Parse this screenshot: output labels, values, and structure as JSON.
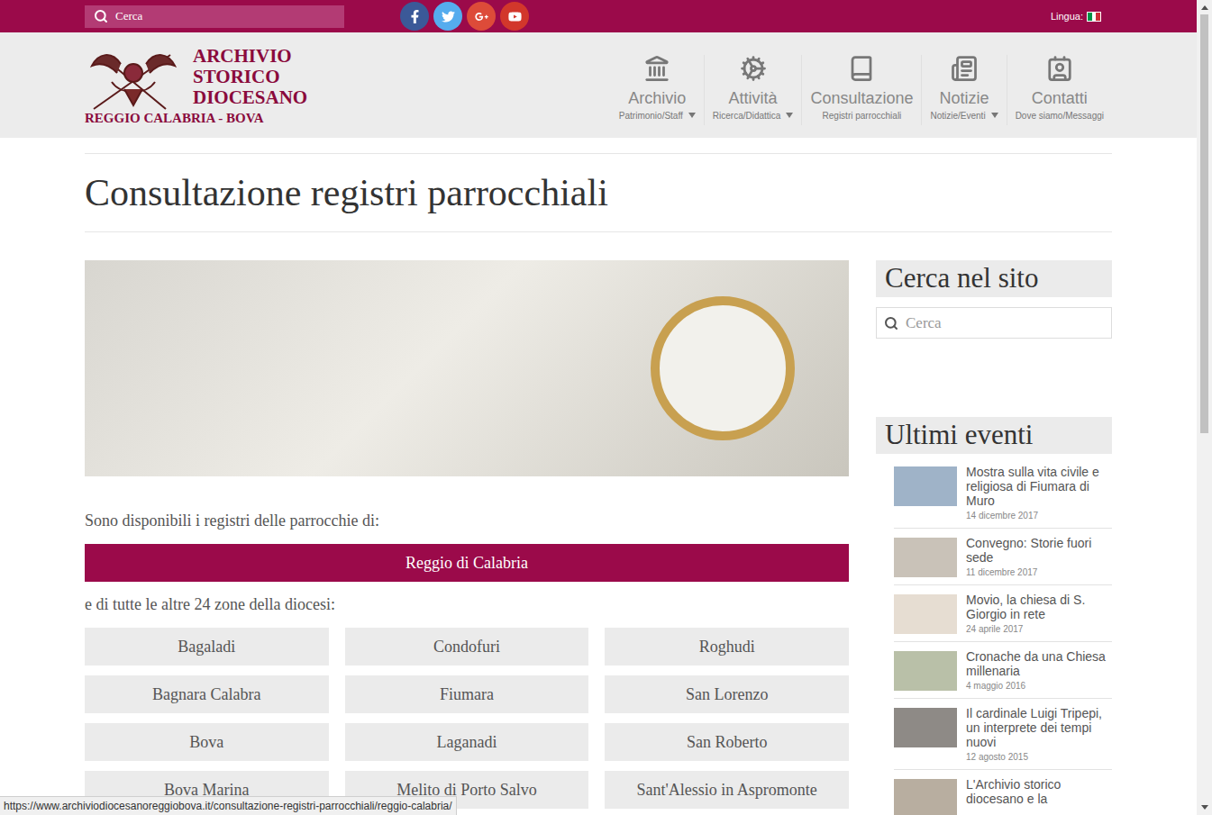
{
  "top_bar": {
    "search_placeholder": "Cerca",
    "social": [
      {
        "name": "facebook",
        "color": "#3b5998"
      },
      {
        "name": "twitter",
        "color": "#55acee"
      },
      {
        "name": "google-plus",
        "color": "#dd4b39"
      },
      {
        "name": "youtube",
        "color": "#d2372b"
      }
    ],
    "language_label": "Lingua:"
  },
  "logo": {
    "lines": [
      "ARCHIVIO",
      "STORICO",
      "DIOCESANO"
    ],
    "subtitle": "REGGIO CALABRIA - BOVA"
  },
  "nav": [
    {
      "label": "Archivio",
      "sub": "Patrimonio/Staff",
      "icon": "landmark",
      "has_dropdown": true
    },
    {
      "label": "Attività",
      "sub": "Ricerca/Didattica",
      "icon": "cog",
      "has_dropdown": true
    },
    {
      "label": "Consultazione",
      "sub": "Registri parrocchiali",
      "icon": "book",
      "has_dropdown": false
    },
    {
      "label": "Notizie",
      "sub": "Notizie/Eventi",
      "icon": "newspaper",
      "has_dropdown": true
    },
    {
      "label": "Contatti",
      "sub": "Dove siamo/Messaggi",
      "icon": "contact",
      "has_dropdown": false
    }
  ],
  "page_title": "Consultazione registri parrocchiali",
  "intro": "Sono disponibili i registri delle parrocchie di:",
  "main_button": "Reggio di Calabria",
  "zones_intro": "e di tutte le altre 24 zone della diocesi:",
  "zones": [
    "Bagaladi",
    "Condofuri",
    "Roghudi",
    "Bagnara Calabra",
    "Fiumara",
    "San Lorenzo",
    "Bova",
    "Laganadi",
    "San Roberto",
    "Bova Marina",
    "Melito di Porto Salvo",
    "Sant'Alessio in Aspromonte"
  ],
  "sidebar": {
    "search_title": "Cerca nel sito",
    "search_placeholder": "Cerca",
    "events_title": "Ultimi eventi",
    "events": [
      {
        "title": "Mostra sulla vita civile e religiosa di Fiumara di Muro",
        "date": "14 dicembre 2017"
      },
      {
        "title": "Convegno: Storie fuori sede",
        "date": "11 dicembre 2017"
      },
      {
        "title": "Movio, la chiesa di S. Giorgio in rete",
        "date": "24 aprile 2017"
      },
      {
        "title": "Cronache da una Chiesa millenaria",
        "date": "4 maggio 2016"
      },
      {
        "title": "Il cardinale Luigi Tripepi, un interprete dei tempi nuovi",
        "date": "12 agosto 2015"
      },
      {
        "title": "L'Archivio storico diocesano e la",
        "date": ""
      }
    ]
  },
  "status_bar": "https://www.archiviodiocesanoreggiobova.it/consultazione-registri-parrocchiali/reggio-calabria/"
}
